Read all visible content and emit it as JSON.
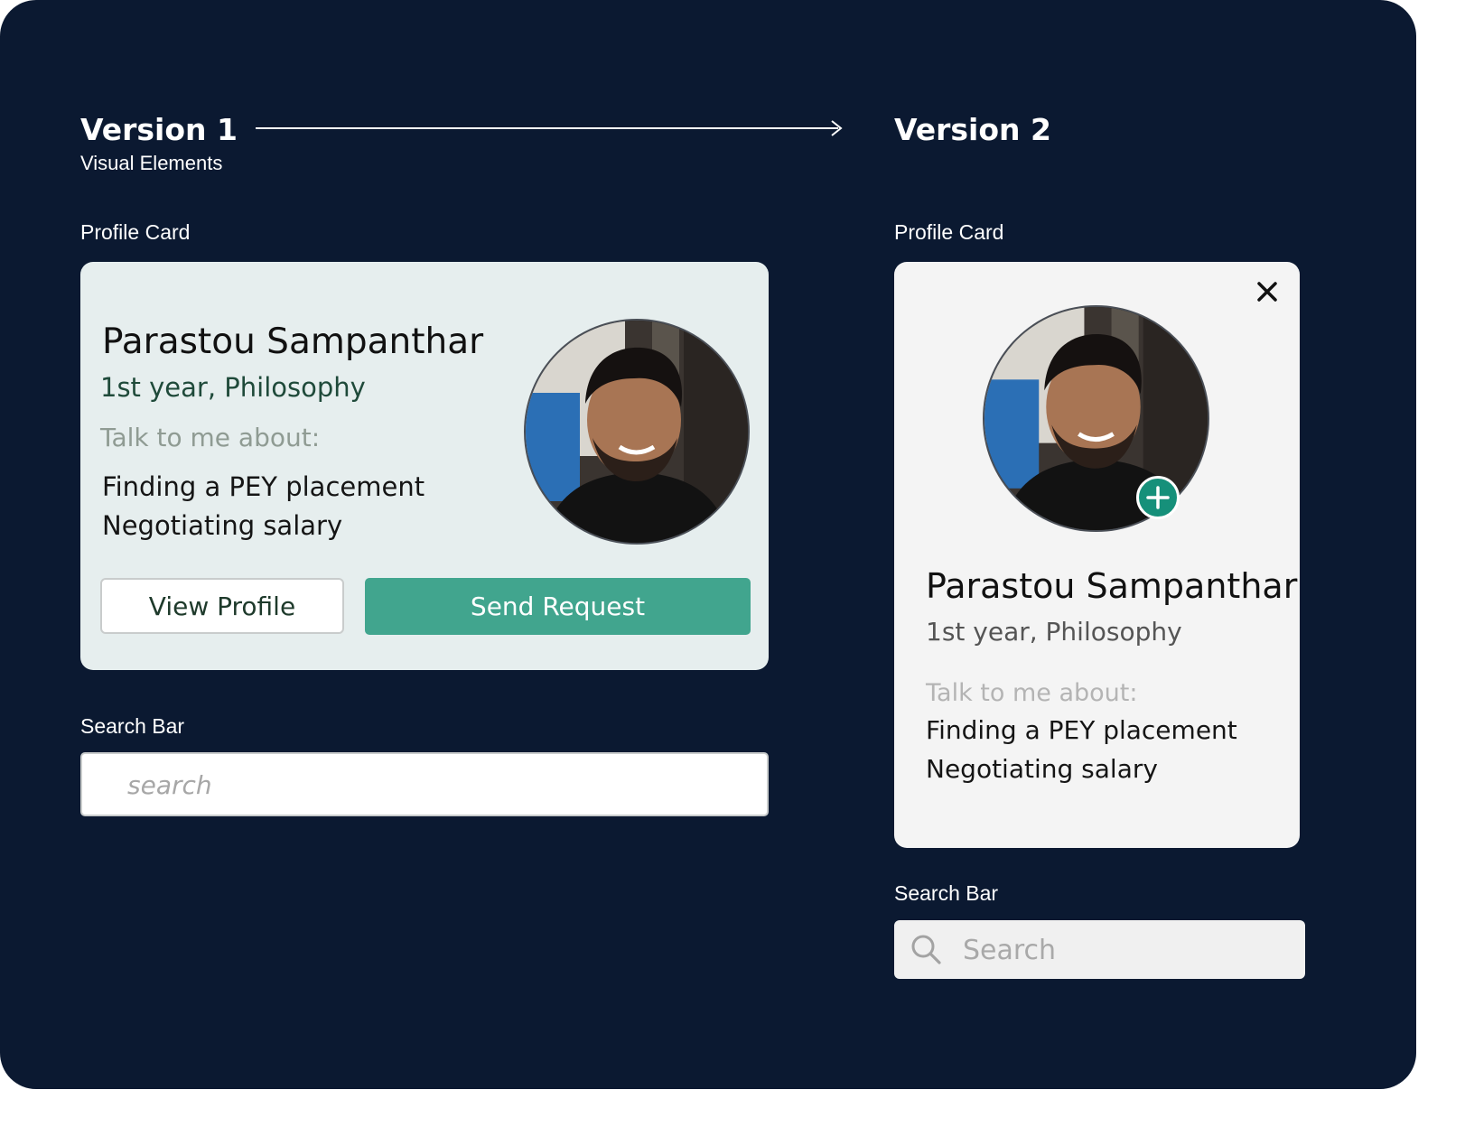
{
  "version1": {
    "title": "Version 1",
    "subtitle": "Visual Elements",
    "profile_card_label": "Profile Card",
    "search_bar_label": "Search Bar",
    "card": {
      "name": "Parastou Sampanthar",
      "year_program": "1st year, Philosophy",
      "talk_heading": "Talk to me about:",
      "topics": [
        "Finding a PEY placement",
        "Negotiating salary"
      ],
      "view_profile_label": "View Profile",
      "send_request_label": "Send Request"
    },
    "search": {
      "placeholder": "search",
      "value": ""
    }
  },
  "version2": {
    "title": "Version 2",
    "profile_card_label": "Profile Card",
    "search_bar_label": "Search Bar",
    "card": {
      "name": "Parastou Sampanthar",
      "year_program": "1st year, Philosophy",
      "talk_heading": "Talk to me about:",
      "topics": [
        "Finding a PEY placement",
        "Negotiating salary"
      ]
    },
    "search": {
      "placeholder": "Search",
      "value": ""
    }
  },
  "colors": {
    "background": "#0b1931",
    "card_v1": "#e6eeee",
    "card_v2": "#f4f4f4",
    "accent_green": "#41a58e",
    "badge_green": "#16907a",
    "program_v1": "#1f4a3a",
    "program_v2": "#555555",
    "muted_v1": "#8f9b93",
    "muted_v2": "#b4b4b4"
  },
  "icons": [
    "arrow-right-icon",
    "close-icon",
    "plus-icon",
    "search-icon",
    "avatar-photo"
  ]
}
